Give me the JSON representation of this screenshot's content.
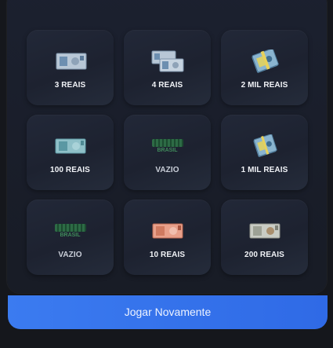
{
  "grid": {
    "tiles": [
      {
        "label": "3 REAIS",
        "icon": "two-bill-icon"
      },
      {
        "label": "4 REAIS",
        "icon": "two-bills-icon"
      },
      {
        "label": "2 MIL REAIS",
        "icon": "money-stack-icon"
      },
      {
        "label": "100 REAIS",
        "icon": "hundred-bill-icon"
      },
      {
        "label": "VAZIO",
        "icon": "empty-logo-icon",
        "logo_text": "BRASIL"
      },
      {
        "label": "1 MIL REAIS",
        "icon": "money-stack-icon"
      },
      {
        "label": "VAZIO",
        "icon": "empty-logo-icon",
        "logo_text": "BRASIL"
      },
      {
        "label": "10 REAIS",
        "icon": "ten-bill-icon"
      },
      {
        "label": "200 REAIS",
        "icon": "two-hundred-bill-icon"
      }
    ]
  },
  "button": {
    "label": "Jogar Novamente"
  },
  "colors": {
    "accent": "#3b7bf0",
    "panel": "#1c2130",
    "tile": "#222838",
    "text": "#f1f3f7"
  }
}
